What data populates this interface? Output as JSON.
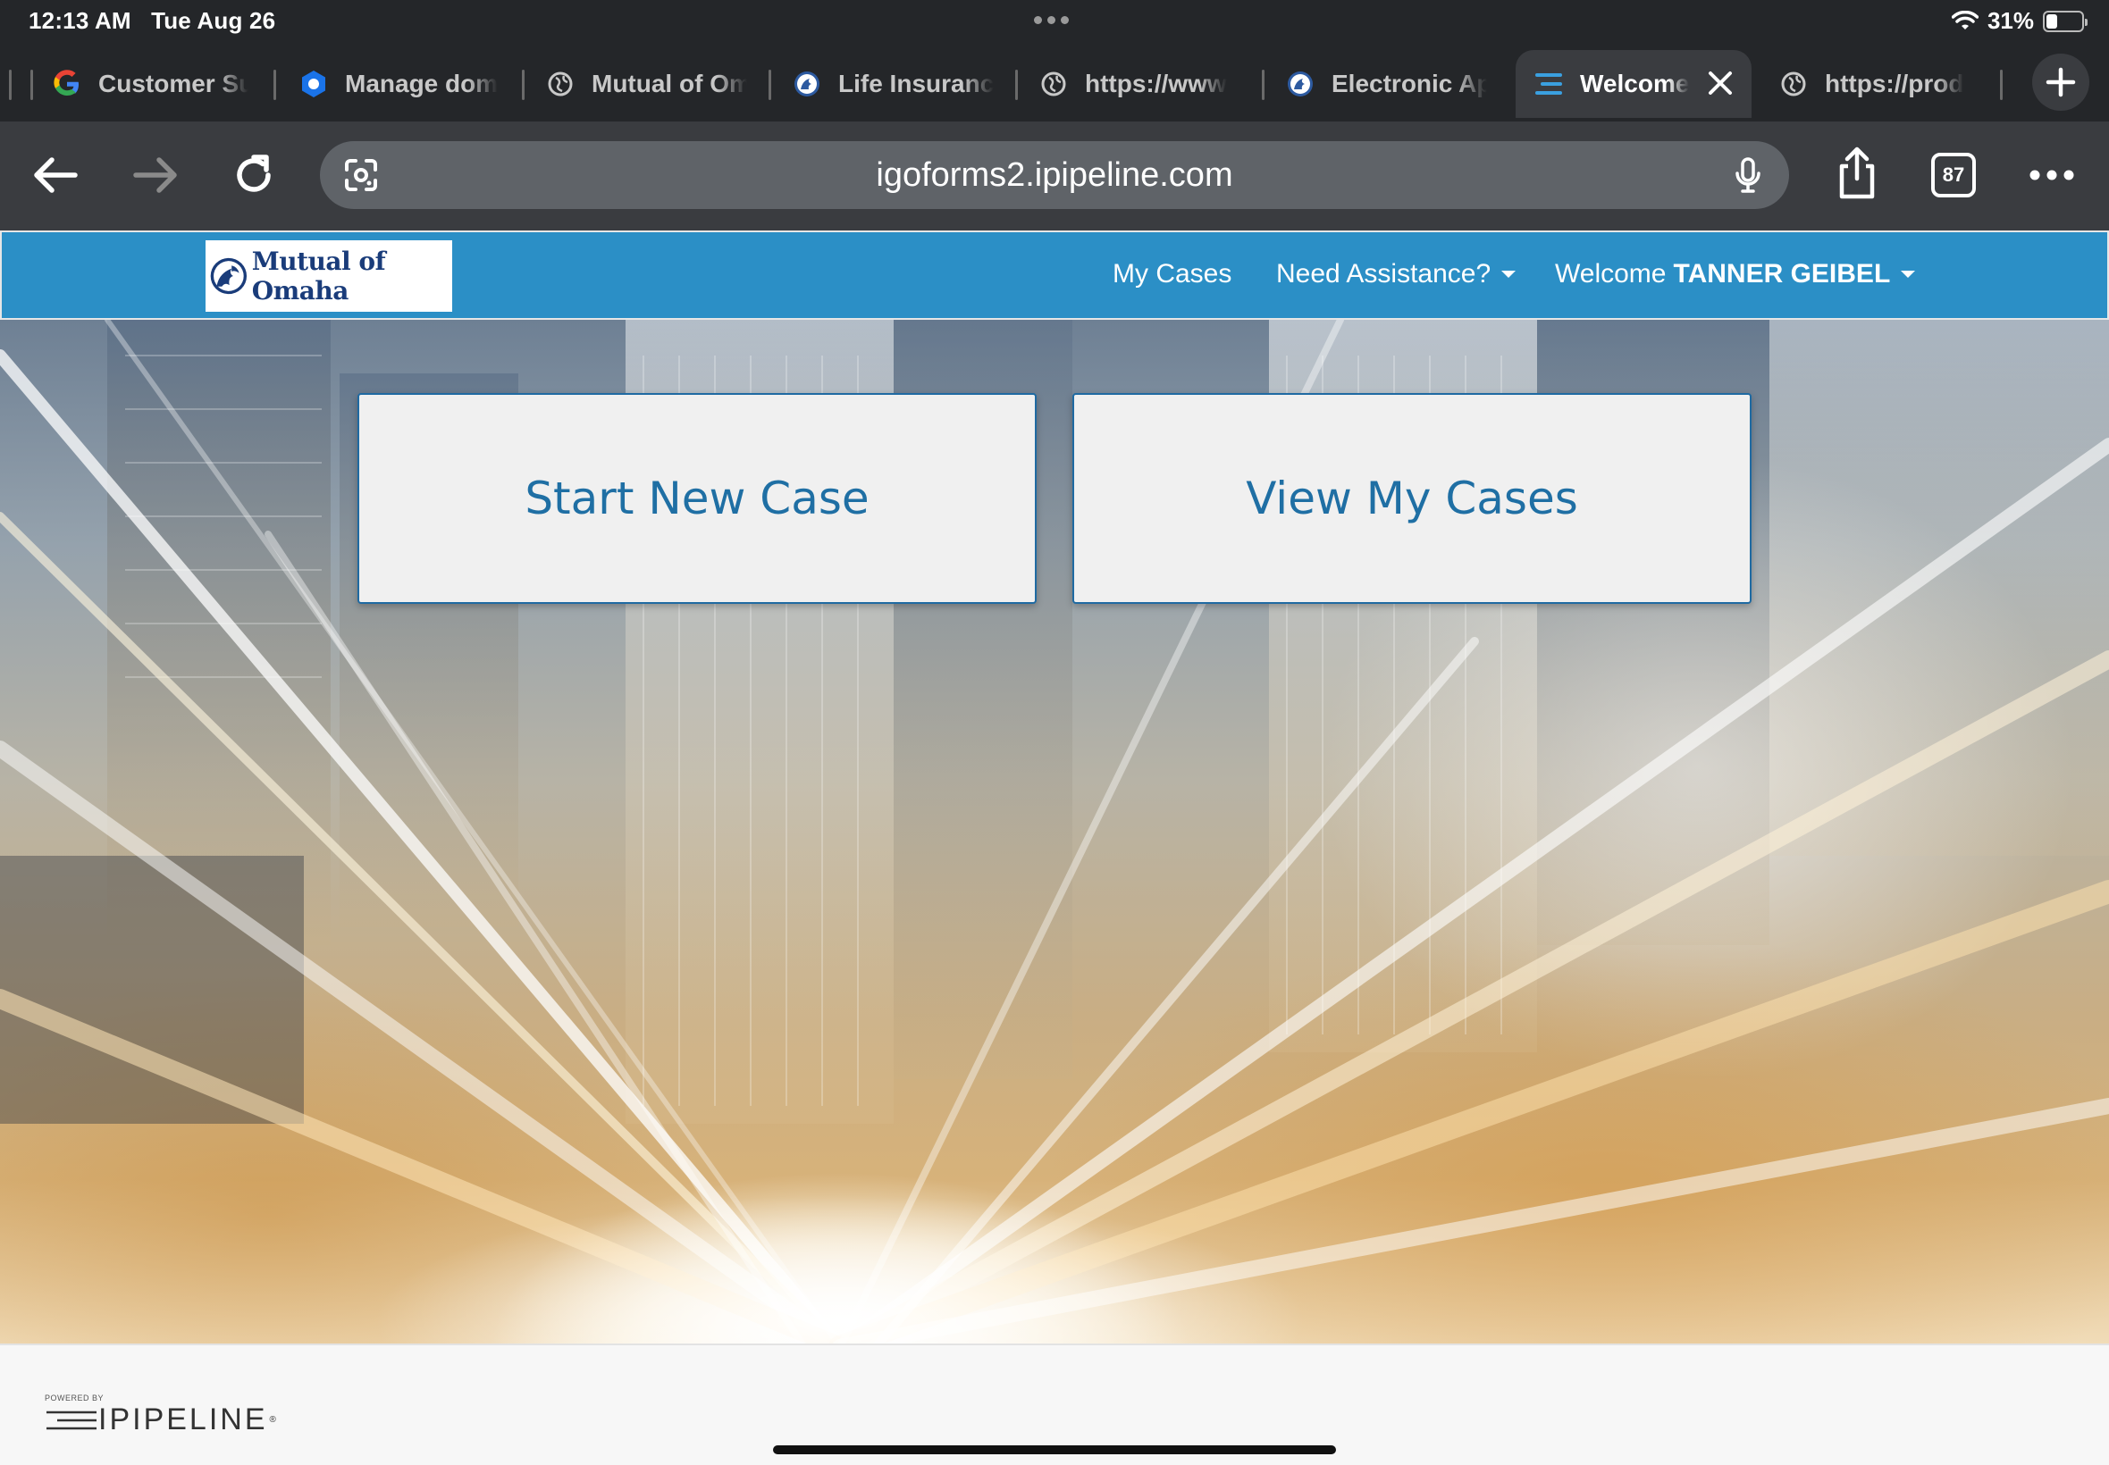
{
  "status_bar": {
    "time": "12:13 AM",
    "date": "Tue Aug 26",
    "battery": "31%",
    "battery_level": 0.31
  },
  "tabs": [
    {
      "label": "Customer Su",
      "icon": "google-icon"
    },
    {
      "label": "Manage dom",
      "icon": "blue-gear-icon"
    },
    {
      "label": "Mutual of Om",
      "icon": "globe-icon"
    },
    {
      "label": "Life Insuranc",
      "icon": "lion-logo-icon"
    },
    {
      "label": "https://www",
      "icon": "globe-icon"
    },
    {
      "label": "Electronic Ap",
      "icon": "lion-logo-icon"
    },
    {
      "label": "Welcome",
      "icon": "ipipeline-icon",
      "active": true
    },
    {
      "label": "https://prod",
      "icon": "globe-icon"
    }
  ],
  "toolbar": {
    "url": "igoforms2.ipipeline.com",
    "tab_count": "87"
  },
  "header": {
    "logo_text": "Mutual of Omaha",
    "nav_my_cases": "My Cases",
    "nav_assistance": "Need Assistance?",
    "nav_welcome": "Welcome",
    "nav_user": "TANNER GEIBEL"
  },
  "main": {
    "start_new_case": "Start New Case",
    "view_my_cases": "View My Cases"
  },
  "footer": {
    "powered_by": "POWERED BY",
    "brand": "IPIPELINE"
  },
  "colors": {
    "header_blue": "#2b8fc6",
    "button_text": "#1f6fa4",
    "chrome_dark": "#242629",
    "toolbar": "#3a3c40"
  }
}
